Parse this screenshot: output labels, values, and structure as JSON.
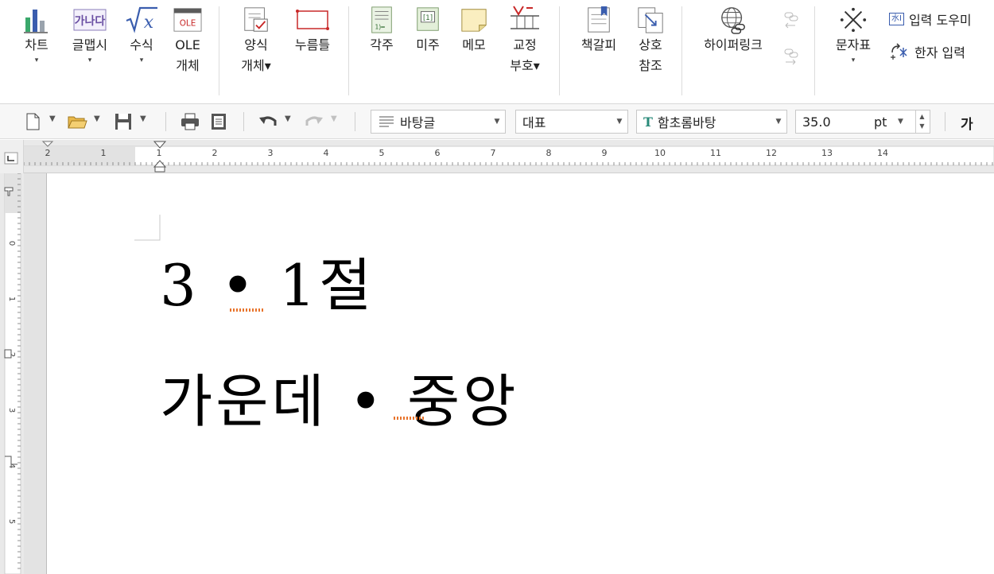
{
  "ribbon": {
    "buttons": [
      {
        "id": "chart",
        "label": "차트",
        "caret": "▾",
        "icon": "chart-icon"
      },
      {
        "id": "wordart",
        "label": "글맵시",
        "caret": "▾",
        "icon": "wordart-icon",
        "icon_text": "가나다"
      },
      {
        "id": "equation",
        "label": "수식",
        "caret": "▾",
        "icon": "equation-icon"
      },
      {
        "id": "ole",
        "label": "OLE\n개체",
        "caret": "",
        "icon": "ole-icon",
        "icon_text": "OLE"
      },
      {
        "id": "form",
        "label": "양식\n개체▾",
        "caret": "",
        "icon": "form-object-icon"
      },
      {
        "id": "click",
        "label": "누름틀",
        "caret": "",
        "icon": "click-field-icon"
      },
      {
        "id": "footnote",
        "label": "각주",
        "caret": "",
        "icon": "footnote-icon"
      },
      {
        "id": "endnote",
        "label": "미주",
        "caret": "",
        "icon": "endnote-icon"
      },
      {
        "id": "memo",
        "label": "메모",
        "caret": "",
        "icon": "memo-icon"
      },
      {
        "id": "proofmark",
        "label": "교정\n부호▾",
        "caret": "",
        "icon": "proofreading-mark-icon"
      },
      {
        "id": "bookmark",
        "label": "책갈피",
        "caret": "",
        "icon": "bookmark-icon"
      },
      {
        "id": "crossref",
        "label": "상호\n참조",
        "caret": "",
        "icon": "cross-reference-icon"
      },
      {
        "id": "hyperlink",
        "label": "하이퍼링크",
        "caret": "",
        "icon": "hyperlink-icon"
      },
      {
        "id": "charmap",
        "label": "문자표",
        "caret": "▾",
        "icon": "character-map-icon"
      }
    ],
    "small": {
      "input_helper": "입력 도우미",
      "input_helper_icon_text": "水I",
      "hanja": "한자 입력"
    }
  },
  "toolbar": {
    "style_combo": "바탕글",
    "lang_combo": "대표",
    "font_combo": "함초롬바탕",
    "size_value": "35.0",
    "size_unit": "pt",
    "bold_label": "가"
  },
  "ruler": {
    "h_ticks": [
      "2",
      "1",
      "1",
      "2",
      "3",
      "4",
      "5",
      "6",
      "7",
      "8",
      "9",
      "10",
      "11",
      "12",
      "13",
      "14"
    ],
    "v_ticks": [
      "0",
      "1",
      "2",
      "3",
      "4",
      "5"
    ]
  },
  "document": {
    "line1": "3 • 1절",
    "line2": "가운데 • 중앙"
  },
  "colors": {
    "accent_blue": "#3a5dae",
    "chart_green": "#3aa86b",
    "spell_underline": "#e8742c"
  }
}
